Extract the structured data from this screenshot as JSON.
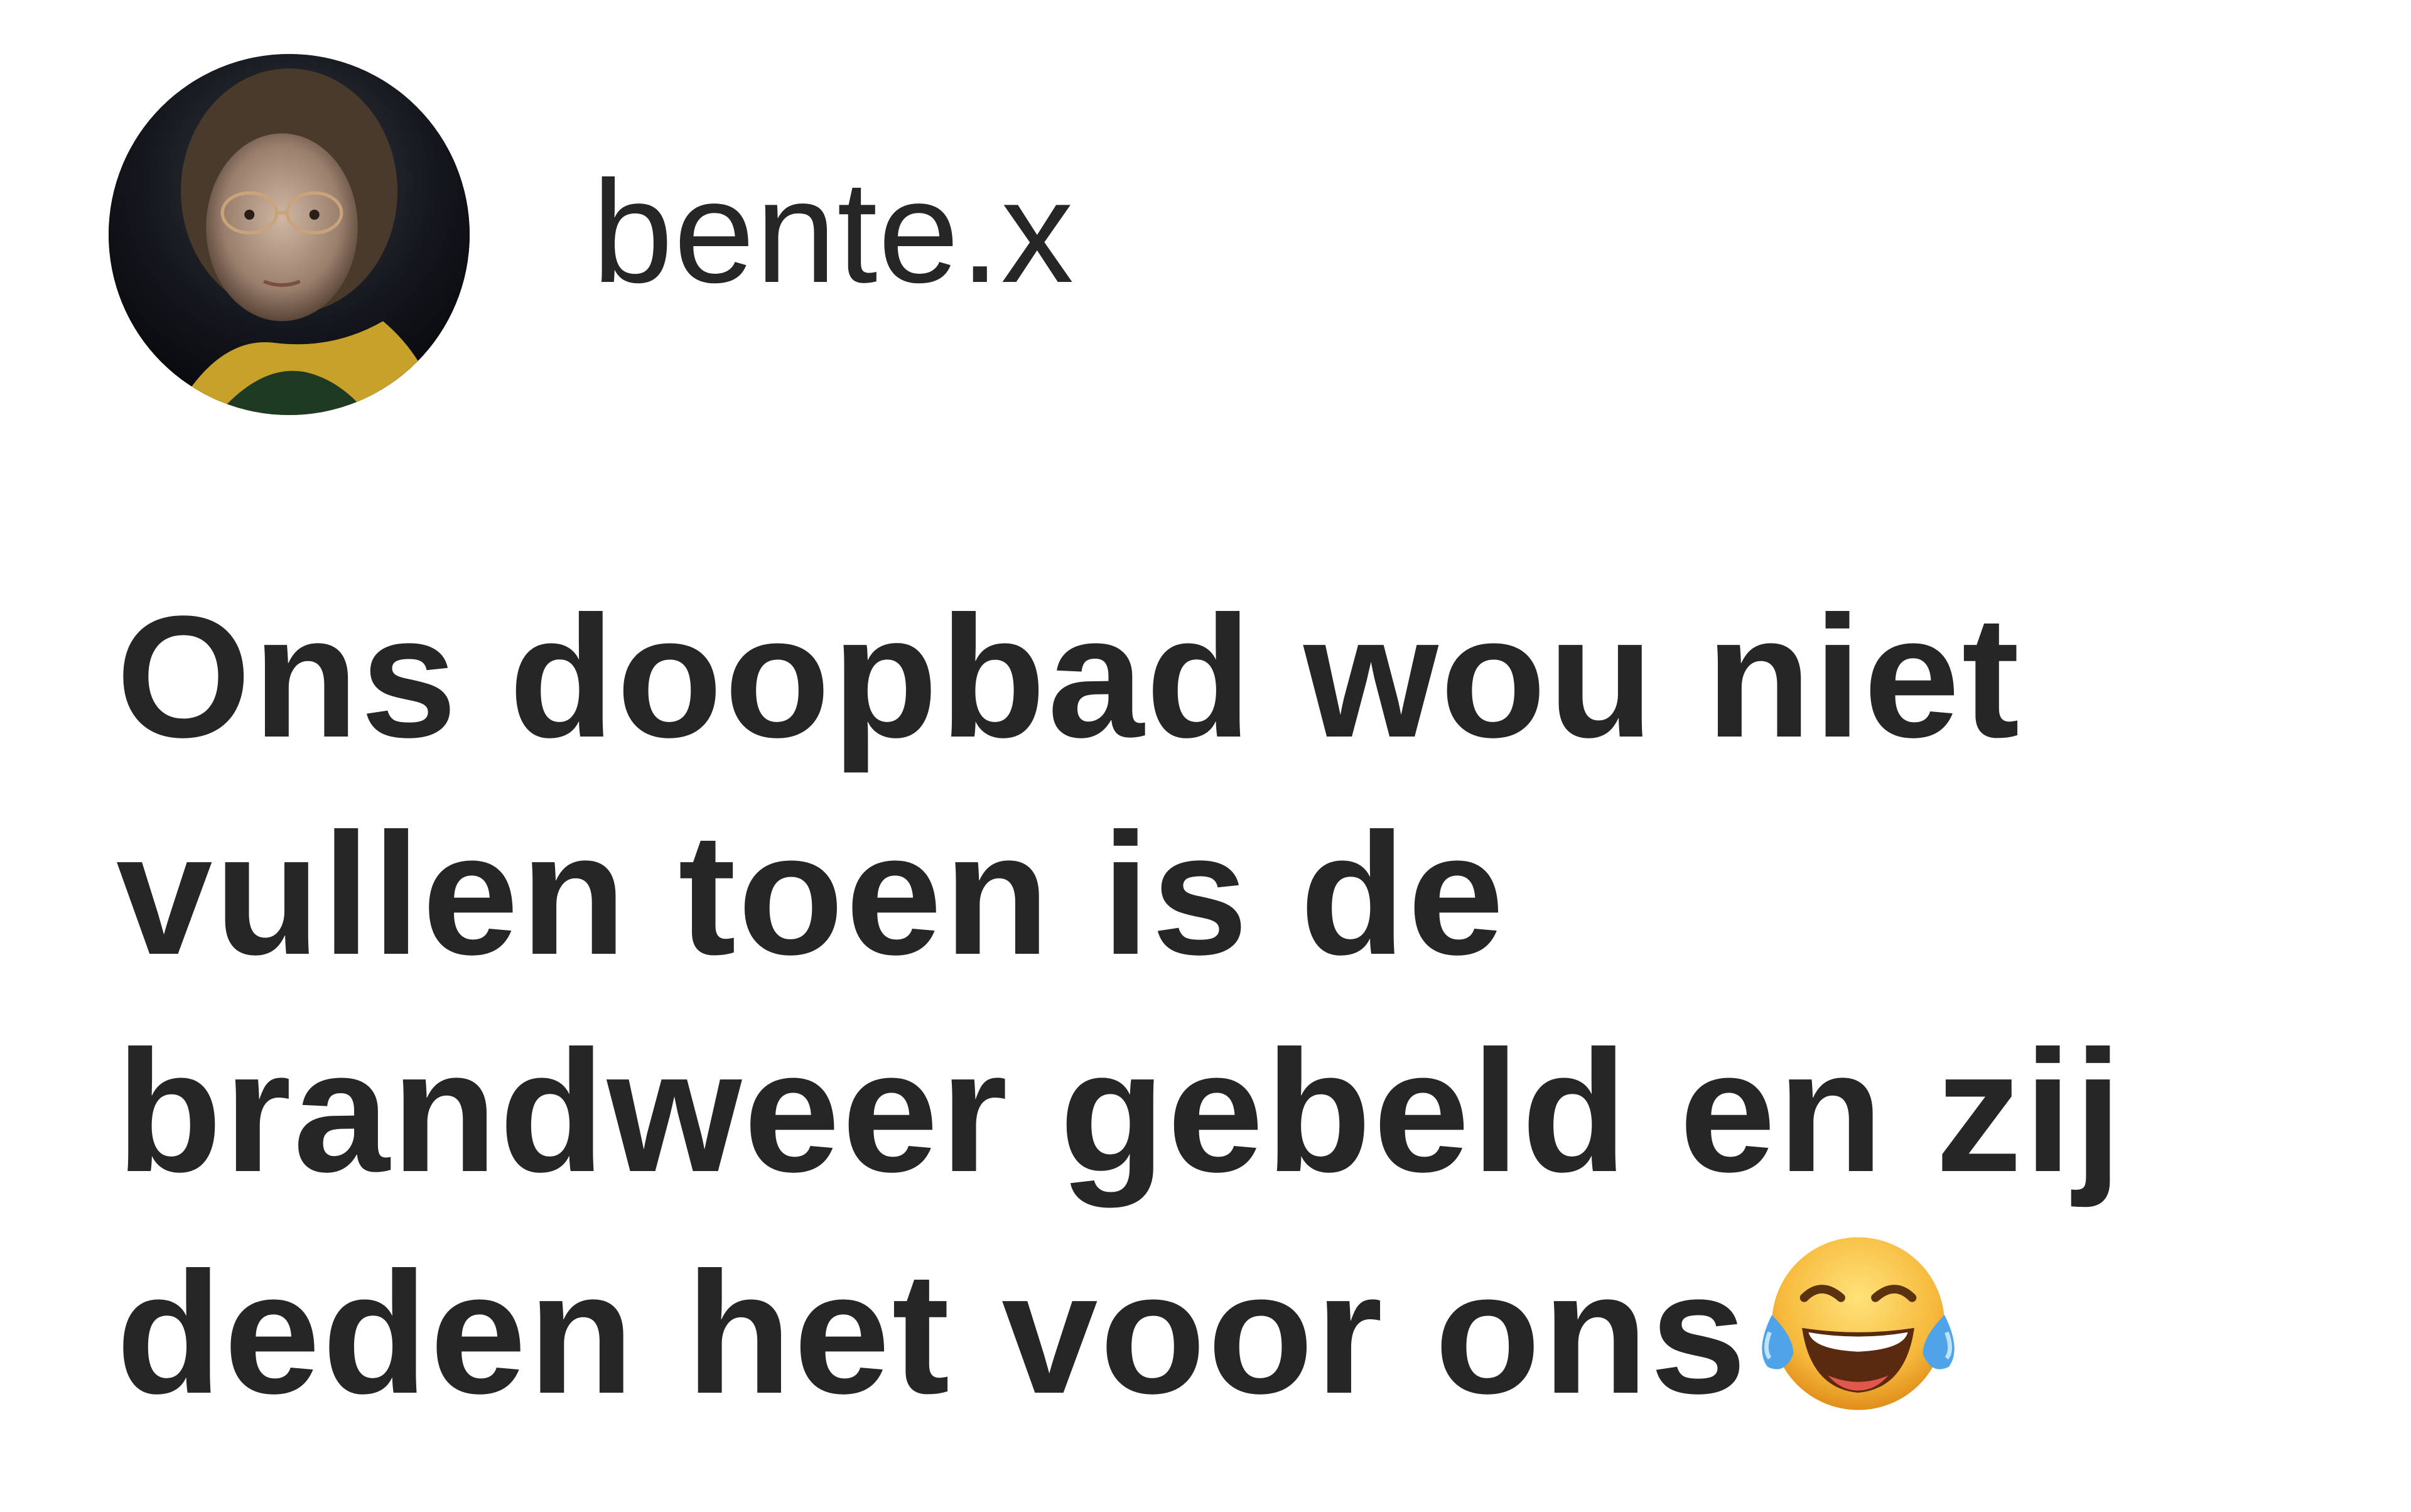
{
  "post": {
    "author": {
      "username": "bente.x",
      "avatar_icon": "profile-photo-avatar"
    },
    "text": "Ons doopbad wou niet\nvullen toen is de\nbrandweer gebeld en zij\ndeden het voor ons",
    "emoji": "face-with-tears-of-joy-icon"
  },
  "colors": {
    "text": "#262626",
    "background": "#ffffff",
    "emoji_face": "#F6B93B",
    "emoji_tears": "#4FA3E8"
  }
}
